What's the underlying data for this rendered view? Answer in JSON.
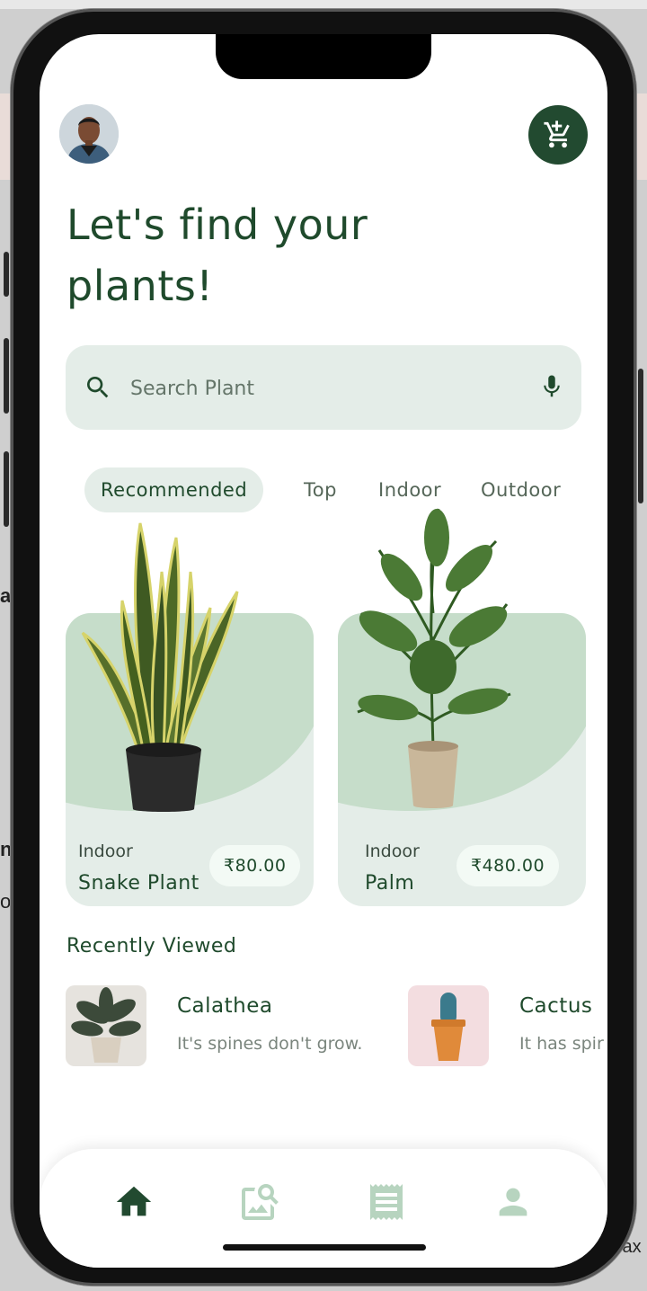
{
  "app": {
    "title_line1": "Let's find your",
    "title_line2": "plants!"
  },
  "search": {
    "placeholder": "Search Plant",
    "value": ""
  },
  "tabs": [
    {
      "label": "Recommended",
      "active": true
    },
    {
      "label": "Top",
      "active": false
    },
    {
      "label": "Indoor",
      "active": false
    },
    {
      "label": "Outdoor",
      "active": false
    }
  ],
  "cards": [
    {
      "category": "Indoor",
      "name": "Snake Plant",
      "price": "₹80.00"
    },
    {
      "category": "Indoor",
      "name": "Palm",
      "price": "₹480.00"
    }
  ],
  "recently_viewed": {
    "title": "Recently Viewed",
    "items": [
      {
        "name": "Calathea",
        "description": "It's spines don't grow."
      },
      {
        "name": "Cactus",
        "description": "It has spir"
      }
    ]
  },
  "nav": {
    "items": [
      {
        "icon": "home-icon",
        "active": true
      },
      {
        "icon": "image-search-icon",
        "active": false
      },
      {
        "icon": "receipt-icon",
        "active": false
      },
      {
        "icon": "person-icon",
        "active": false
      }
    ]
  },
  "background_side_text": {
    "left_1": "ab",
    "left_2": "n)",
    "left_3": "or",
    "right_1": "lax"
  },
  "colors": {
    "primary": "#224a30",
    "accent_light": "#e4ede8",
    "card_blob": "#c6ddca",
    "nav_inactive": "#b7d4bf"
  }
}
